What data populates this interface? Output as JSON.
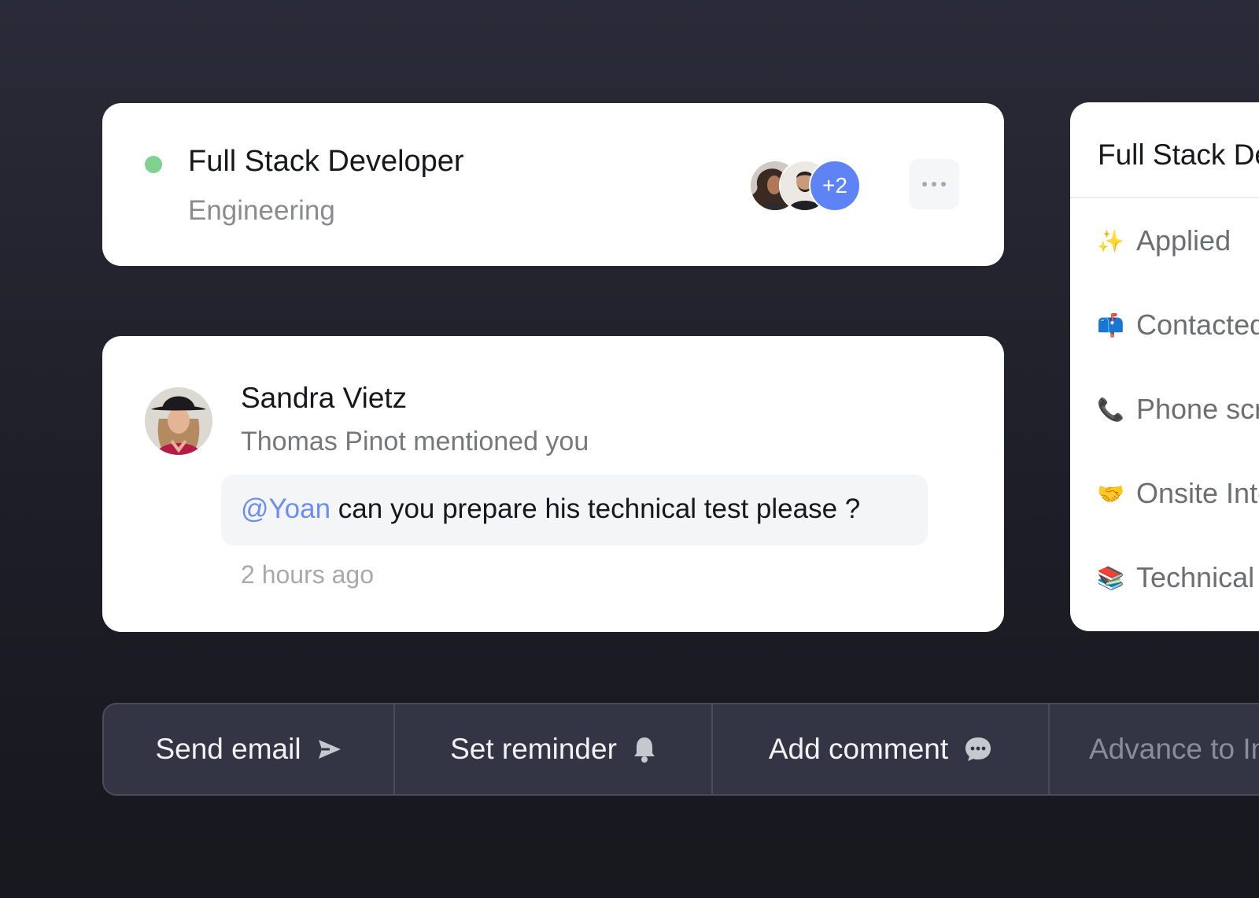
{
  "job_card": {
    "title": "Full Stack Developer",
    "department": "Engineering",
    "status_color": "#7fd18f",
    "extra_members": "+2",
    "more_icon": "more-horizontal-icon"
  },
  "notification": {
    "author": "Sandra Vietz",
    "subtitle": "Thomas Pinot mentioned you",
    "mention": "@Yoan",
    "message": " can you prepare his technical test please ?",
    "time": "2 hours ago",
    "mention_color": "#6c8df3"
  },
  "pipeline": {
    "title": "Full Stack Developer",
    "stages": [
      {
        "emoji": "✨",
        "label": "Applied"
      },
      {
        "emoji": "📫",
        "label": "Contacted"
      },
      {
        "emoji": "📞",
        "label": "Phone screen"
      },
      {
        "emoji": "🤝",
        "label": "Onsite Interview"
      },
      {
        "emoji": "📚",
        "label": "Technical test"
      }
    ]
  },
  "actions": {
    "send_email": "Send email",
    "set_reminder": "Set reminder",
    "add_comment": "Add comment",
    "advance": "Advance to Interview"
  },
  "colors": {
    "accent": "#5e83f5",
    "background": "#23242e"
  }
}
